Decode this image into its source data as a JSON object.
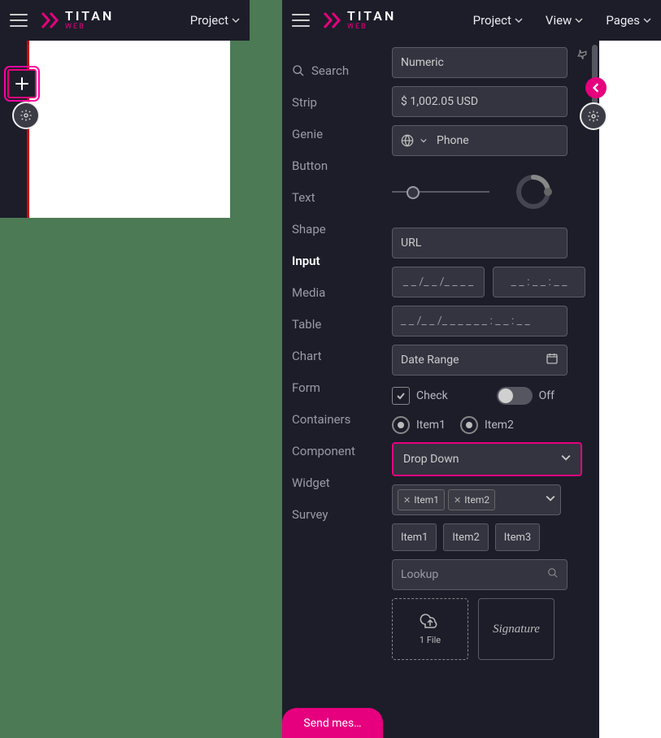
{
  "brand": {
    "name": "TITAN",
    "sub": "WEB"
  },
  "left_header": {
    "project_label": "Project"
  },
  "right_header": {
    "project_label": "Project",
    "view_label": "View",
    "pages_label": "Pages"
  },
  "categories": {
    "search": "Search",
    "items": [
      "Strip",
      "Genie",
      "Button",
      "Text",
      "Shape",
      "Input",
      "Media",
      "Table",
      "Chart",
      "Form",
      "Containers",
      "Component",
      "Widget",
      "Survey"
    ],
    "active": "Input"
  },
  "components": {
    "numeric": "Numeric",
    "currency": "$ 1,002.05 USD",
    "phone": "Phone",
    "url": "URL",
    "date_ph": "_ _ /_ _ /_ _ _ _",
    "time_ph": "_ _ : _ _ : _ _",
    "datetime_ph": "_ _ /_ _ /_ _ _ _       _ _ : _ _ : _ _",
    "date_range": "Date Range",
    "check": "Check",
    "toggle_off": "Off",
    "radio1": "Item1",
    "radio2": "Item2",
    "dropdown": "Drop Down",
    "multi": {
      "item1": "Item1",
      "item2": "Item2"
    },
    "tags": {
      "t1": "Item1",
      "t2": "Item2",
      "t3": "Item3"
    },
    "lookup": "Lookup",
    "upload": "1 File",
    "signature": "Signature"
  },
  "send_label": "Send mes…"
}
